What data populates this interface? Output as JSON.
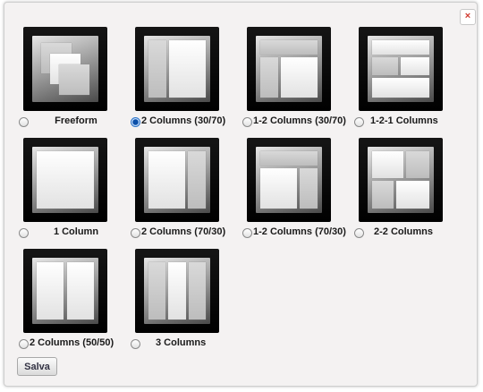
{
  "dialog": {
    "close_label": "×",
    "save_label": "Salva"
  },
  "layouts": [
    {
      "label": "Freeform",
      "selected": false
    },
    {
      "label": "2 Columns (30/70)",
      "selected": true
    },
    {
      "label": "1-2 Columns (30/70)",
      "selected": false
    },
    {
      "label": "1-2-1 Columns",
      "selected": false
    },
    {
      "label": "1 Column",
      "selected": false
    },
    {
      "label": "2 Columns (70/30)",
      "selected": false
    },
    {
      "label": "1-2 Columns (70/30)",
      "selected": false
    },
    {
      "label": "2-2 Columns",
      "selected": false
    },
    {
      "label": "2 Columns (50/50)",
      "selected": false
    },
    {
      "label": "3 Columns",
      "selected": false
    }
  ]
}
